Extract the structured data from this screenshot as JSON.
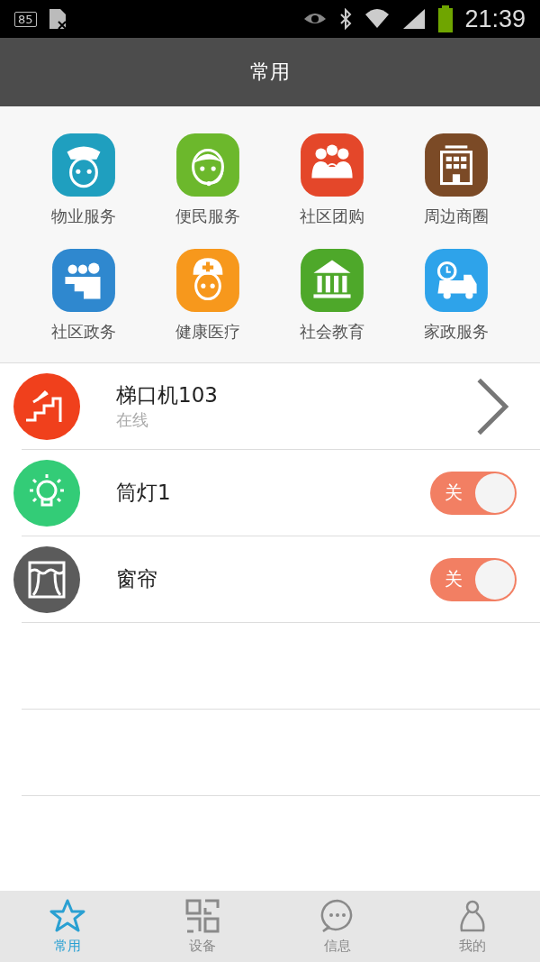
{
  "status_bar": {
    "battery": "85",
    "time": "21:39"
  },
  "title_bar": {
    "title": "常用"
  },
  "services": [
    {
      "label": "物业服务",
      "color": "#1f9fbf"
    },
    {
      "label": "便民服务",
      "color": "#6cb82c"
    },
    {
      "label": "社区团购",
      "color": "#e4472a"
    },
    {
      "label": "周边商圈",
      "color": "#7b4a26"
    },
    {
      "label": "社区政务",
      "color": "#2f88cf"
    },
    {
      "label": "健康医疗",
      "color": "#f7981c"
    },
    {
      "label": "社会教育",
      "color": "#4ea82a"
    },
    {
      "label": "家政服务",
      "color": "#2ea3ea"
    }
  ],
  "devices": [
    {
      "kind": "link",
      "name": "梯口机103",
      "status": "在线",
      "color": "#f0401c"
    },
    {
      "kind": "toggle",
      "name": "筒灯1",
      "on": false,
      "switch_label": "关",
      "color": "#33cc77"
    },
    {
      "kind": "toggle",
      "name": "窗帘",
      "on": false,
      "switch_label": "关",
      "color": "#5b5b5b"
    }
  ],
  "tabs": [
    {
      "label": "常用",
      "selected": true
    },
    {
      "label": "设备",
      "selected": false
    },
    {
      "label": "信息",
      "selected": false
    },
    {
      "label": "我的",
      "selected": false
    }
  ]
}
